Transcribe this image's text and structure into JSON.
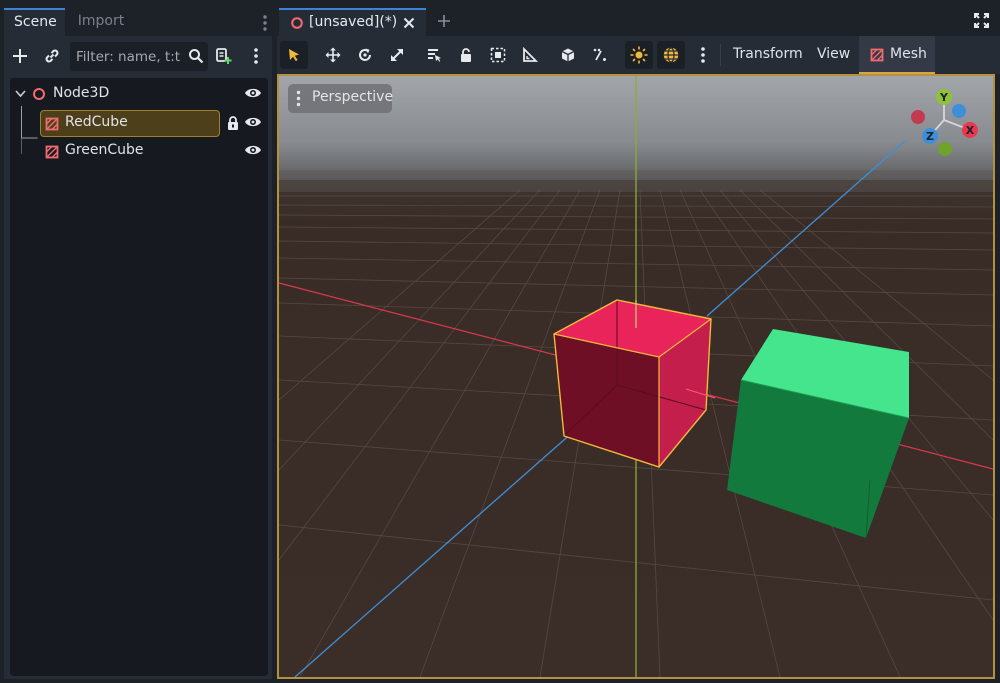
{
  "scene_dock": {
    "tabs": [
      {
        "label": "Scene",
        "active": true
      },
      {
        "label": "Import",
        "active": false
      }
    ],
    "filter_placeholder": "Filter: name, t:t",
    "tree": [
      {
        "label": "Node3D",
        "icon": "node3d-icon",
        "expanded": true,
        "visible": true
      },
      {
        "label": "RedCube",
        "icon": "mesh-instance-icon",
        "selected": true,
        "locked": true,
        "visible": true
      },
      {
        "label": "GreenCube",
        "icon": "mesh-instance-icon",
        "visible": true
      }
    ]
  },
  "editor": {
    "scene_tab": "[unsaved](*)",
    "menus": {
      "transform": "Transform",
      "view": "View",
      "mesh": "Mesh"
    },
    "viewport": {
      "mode_label": "Perspective",
      "gizmo": {
        "x": "X",
        "y": "Y",
        "z": "Z"
      }
    }
  },
  "colors": {
    "accent_blue": "#3e84d5",
    "selection_gold": "#d6a545",
    "axis_x": "#e8384f",
    "axis_y": "#8fc13a",
    "axis_z": "#3e8fd8",
    "red_cube": "#e8245a",
    "green_cube": "#44e58c"
  }
}
